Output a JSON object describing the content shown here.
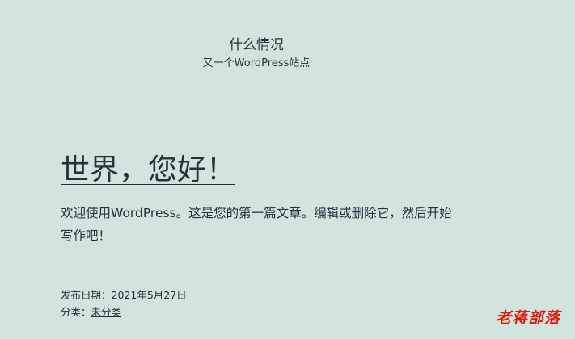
{
  "header": {
    "site_title": "什么情况",
    "site_description": "又一个WordPress站点"
  },
  "post": {
    "title": "世界，您好！",
    "content": "欢迎使用WordPress。这是您的第一篇文章。编辑或删除它，然后开始写作吧！",
    "published_label": "发布日期：",
    "published_date": "2021年5月27日",
    "category_label": "分类：",
    "category": "未分类"
  },
  "watermark": {
    "text": "老蒋部落",
    "color": "#e8170e"
  },
  "colors": {
    "background": "#d1e4dd",
    "text": "#28303d"
  }
}
